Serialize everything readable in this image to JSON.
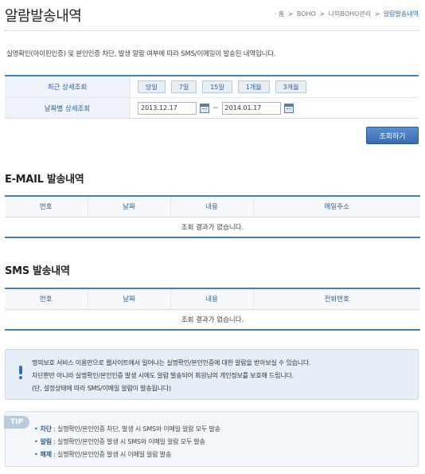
{
  "page": {
    "title": "알람발송내역",
    "intro": "실명확인(아이핀인증) 및 본인인증 차단, 발생 알람 여부에 따라 SMS/이메일이 발송된 내역입니다."
  },
  "breadcrumb": {
    "home": "· 홈",
    "item1": "BOHO",
    "item2": "나의BOHO관리",
    "current": "알람발송내역",
    "sep": ">"
  },
  "search": {
    "recent_label": "최근 상세조회",
    "date_label": "날짜별 상세조회",
    "periods": [
      "당일",
      "7일",
      "15일",
      "1개월",
      "3개월"
    ],
    "date_from": "2013.12.17",
    "date_to": "2014.01.17",
    "tilde": "~",
    "button_label": "조회하기"
  },
  "email_section": {
    "title": "E-MAIL 발송내역",
    "columns": [
      "번호",
      "날짜",
      "내용",
      "메일주소"
    ],
    "empty_message": "조회 결과가 없습니다."
  },
  "sms_section": {
    "title": "SMS 발송내역",
    "columns": [
      "번호",
      "날짜",
      "내용",
      "전화번호"
    ],
    "empty_message": "조회 결과가 없습니다."
  },
  "notice": {
    "lines": [
      "명의보호 서비스 이용만으로 웹사이트에서 일어나는 실명확인/본인인증에 대한 알람을 받아보실 수 있습니다.",
      "차단뿐만 아니라 실명확인/본인인증 발생 시에도 알람 발송되어 회원님의 개인정보를 보호해 드립니다.",
      "(단, 설정상태에 따라 SMS/이메일 알람이 발송됩니다)"
    ]
  },
  "tip": {
    "badge": "TIP",
    "items": [
      {
        "key": "차단",
        "text": " : 실명확인/본인인증 차단, 발생 시 SMS와 이메일 알람 모두 발송"
      },
      {
        "key": "알림",
        "text": " : 실명확인/본인인증 발생 시 SMS와 이메일 알람 모두 발송"
      },
      {
        "key": "해제",
        "text": " : 실명확인/본인인증 발생 시 이메일 알람 발송"
      }
    ]
  },
  "colors": {
    "accent": "#4a7fb6",
    "label_text": "#2f5f95",
    "button": "#3b6cb0"
  }
}
